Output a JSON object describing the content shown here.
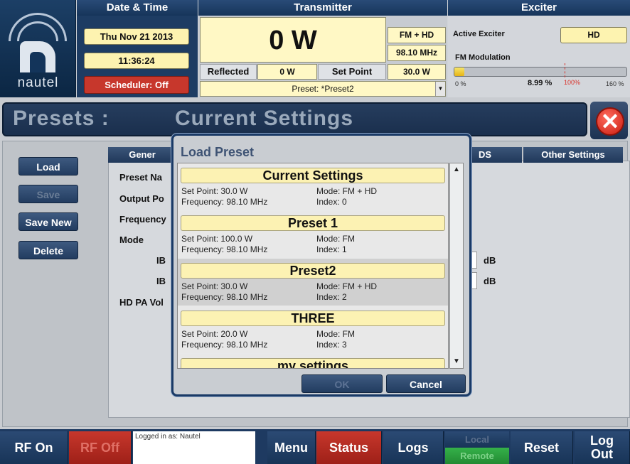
{
  "header": {
    "logo_text": "nautel",
    "date_time": {
      "heading": "Date & Time",
      "date": "Thu Nov 21 2013",
      "time": "11:36:24",
      "scheduler": "Scheduler: Off"
    },
    "transmitter": {
      "heading": "Transmitter",
      "forward_power": "0 W",
      "mode": "FM + HD",
      "frequency": "98.10 MHz",
      "reflected_label": "Reflected",
      "reflected_value": "0 W",
      "set_point_label": "Set Point",
      "set_point_value": "30.0 W",
      "preset": "Preset: *Preset2"
    },
    "exciter": {
      "heading": "Exciter",
      "active_label": "Active Exciter",
      "active_value": "HD",
      "fm_mod_label": "FM Modulation",
      "fm_mod_value": "8.99 %",
      "fm_mod_fraction": 0.0562,
      "scale_min": "0 %",
      "scale_mid": "100%",
      "scale_max": "160 %"
    }
  },
  "page": {
    "title_left": "Presets :",
    "title_right": "Current Settings"
  },
  "sidebar": {
    "load": "Load",
    "save": "Save",
    "save_new": "Save New",
    "delete": "Delete"
  },
  "tabs": {
    "general": "Gener",
    "ds": "DS",
    "other": "Other Settings"
  },
  "form": {
    "preset_name": "Preset Na",
    "output_power": "Output Po",
    "frequency": "Frequency",
    "mode": "Mode",
    "ib1": "IB",
    "ib2": "IB",
    "hd_pa": "HD PA Vol",
    "db1": "dB",
    "db2": "dB"
  },
  "modal": {
    "title": "Load Preset",
    "items": [
      {
        "name": "Current Settings",
        "set_point": "Set Point: 30.0 W",
        "mode": "Mode: FM + HD",
        "frequency": "Frequency: 98.10 MHz",
        "index": "Index: 0"
      },
      {
        "name": "Preset 1",
        "set_point": "Set Point: 100.0 W",
        "mode": "Mode: FM",
        "frequency": "Frequency: 98.10 MHz",
        "index": "Index: 1"
      },
      {
        "name": "Preset2",
        "set_point": "Set Point: 30.0 W",
        "mode": "Mode: FM + HD",
        "frequency": "Frequency: 98.10 MHz",
        "index": "Index: 2"
      },
      {
        "name": "THREE",
        "set_point": "Set Point: 20.0 W",
        "mode": "Mode: FM",
        "frequency": "Frequency: 98.10 MHz",
        "index": "Index: 3"
      },
      {
        "name": "my settings"
      }
    ],
    "ok": "OK",
    "cancel": "Cancel"
  },
  "footer": {
    "rf_on": "RF On",
    "rf_off": "RF Off",
    "logged_in": "Logged in as: Nautel",
    "menu": "Menu",
    "status": "Status",
    "logs": "Logs",
    "local": "Local",
    "remote": "Remote",
    "reset": "Reset",
    "log": "Log",
    "out": "Out"
  }
}
